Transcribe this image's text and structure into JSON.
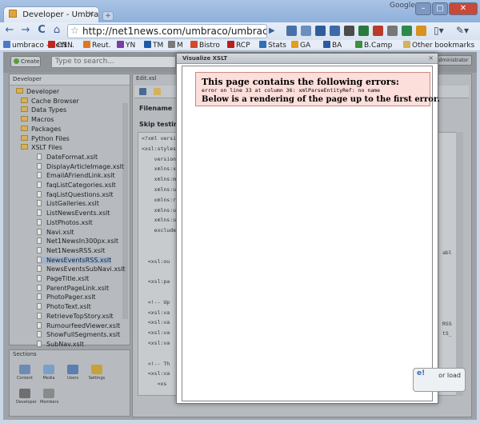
{
  "window": {
    "tab_title": "Developer - Umbra...",
    "tab_close": "×",
    "new_tab": "+",
    "user": "Google",
    "controls": {
      "minimize": "–",
      "maximize": "□",
      "close": "✕"
    }
  },
  "toolbar": {
    "back": "←",
    "forward": "→",
    "reload": "C",
    "home": "⌂",
    "star": "☆",
    "url": "http://net1news.com/umbraco/umbraco.aspx#c",
    "go": "▶",
    "page_menu": "▯▾",
    "tools_menu": "✎▾"
  },
  "bookmarks": [
    {
      "label": "umbraco - net1...",
      "color": "#4a7bc1"
    },
    {
      "label": "CNN",
      "color": "#c0281f"
    },
    {
      "label": "Reut.",
      "color": "#e07820"
    },
    {
      "label": "YN",
      "color": "#7a3e9c"
    },
    {
      "label": "TM",
      "color": "#1d5aa5"
    },
    {
      "label": "M",
      "color": "#7a7a7a"
    },
    {
      "label": "Bistro",
      "color": "#d24b2a"
    },
    {
      "label": "RCP",
      "color": "#b81f1f"
    },
    {
      "label": "Stats",
      "color": "#2f6fb5"
    },
    {
      "label": "GA",
      "color": "#e59d1b"
    },
    {
      "label": "BA",
      "color": "#2e5aa0"
    },
    {
      "label": "B.Camp",
      "color": "#3e8f3e"
    },
    {
      "label": "Other bookmarks",
      "color": "#d4b15e"
    }
  ],
  "umbraco": {
    "create_label": "Create",
    "search_placeholder": "Type to search...",
    "admin_label": "Administrator",
    "tree_header": "Developer",
    "tree": [
      {
        "label": "Developer",
        "type": "folder"
      },
      {
        "label": "Cache Browser",
        "type": "folder"
      },
      {
        "label": "Data Types",
        "type": "folder"
      },
      {
        "label": "Macros",
        "type": "folder"
      },
      {
        "label": "Packages",
        "type": "folder"
      },
      {
        "label": "Python Files",
        "type": "folder"
      },
      {
        "label": "XSLT Files",
        "type": "folder"
      },
      {
        "label": "DateFormat.xslt",
        "type": "file"
      },
      {
        "label": "DisplayArticleImage.xslt",
        "type": "file"
      },
      {
        "label": "EmailAFriendLink.xslt",
        "type": "file"
      },
      {
        "label": "faqListCategories.xslt",
        "type": "file"
      },
      {
        "label": "faqListQuestions.xslt",
        "type": "file"
      },
      {
        "label": "ListGalleries.xslt",
        "type": "file"
      },
      {
        "label": "ListNewsEvents.xslt",
        "type": "file"
      },
      {
        "label": "ListPhotos.xslt",
        "type": "file"
      },
      {
        "label": "Navi.xslt",
        "type": "file"
      },
      {
        "label": "Net1NewsIn300px.xslt",
        "type": "file"
      },
      {
        "label": "Net1NewsRSS.xslt",
        "type": "file"
      },
      {
        "label": "NewsEventsRSS.xslt",
        "type": "file"
      },
      {
        "label": "NewsEventsSubNavi.xslt",
        "type": "file"
      },
      {
        "label": "PageTitle.xslt",
        "type": "file"
      },
      {
        "label": "ParentPageLink.xslt",
        "type": "file"
      },
      {
        "label": "PhotoPager.xslt",
        "type": "file"
      },
      {
        "label": "PhotoText.xslt",
        "type": "file"
      },
      {
        "label": "RetrieveTopStory.xslt",
        "type": "file"
      },
      {
        "label": "RumourfeedViewer.xslt",
        "type": "file"
      },
      {
        "label": "ShowFullSegments.xslt",
        "type": "file"
      },
      {
        "label": "SubNav.xslt",
        "type": "file"
      }
    ],
    "sections_header": "Sections",
    "sections": [
      {
        "label": "Content",
        "color": "#6d8bb3"
      },
      {
        "label": "Media",
        "color": "#7ba0c8"
      },
      {
        "label": "Users",
        "color": "#5a7fb0"
      },
      {
        "label": "Settings",
        "color": "#c7a23a"
      },
      {
        "label": "Developer",
        "color": "#6f6f6f"
      },
      {
        "label": "Members",
        "color": "#8a8a8a"
      }
    ],
    "editor_header": "Edit.xsl",
    "filename_label": "Filename",
    "skip_label": "Skip testing (i",
    "code_lines": [
      "<?xml versi",
      "<xsl:styles",
      "    version",
      "    xmlns:x",
      "    xmlns:m",
      "    xmlns:u",
      "    xmlns:r",
      "    xmlns:u",
      "    xmlns:u",
      "    exclude",
      "",
      "",
      "  <xsl:ou",
      "",
      "  <xsl:pa",
      "",
      "  <!-- Up",
      "  <xsl:va",
      "  <xsl:va",
      "  <xsl:va",
      "  <xsl:va",
      "",
      "  <!-- Th",
      "  <xsl:va",
      "     <xs"
    ],
    "code_right": [
      "abl",
      "RSS",
      "tS_"
    ]
  },
  "modal": {
    "title": "Visualize XSLT",
    "close": "×",
    "error_title": "This page contains the following errors:",
    "error_message": "error on line 33 at column 36: xmlParseEntityRef: no name",
    "error_below": "Below is a rendering of the page up to the first error."
  },
  "notify": {
    "bang": "e!",
    "text": "or load"
  }
}
